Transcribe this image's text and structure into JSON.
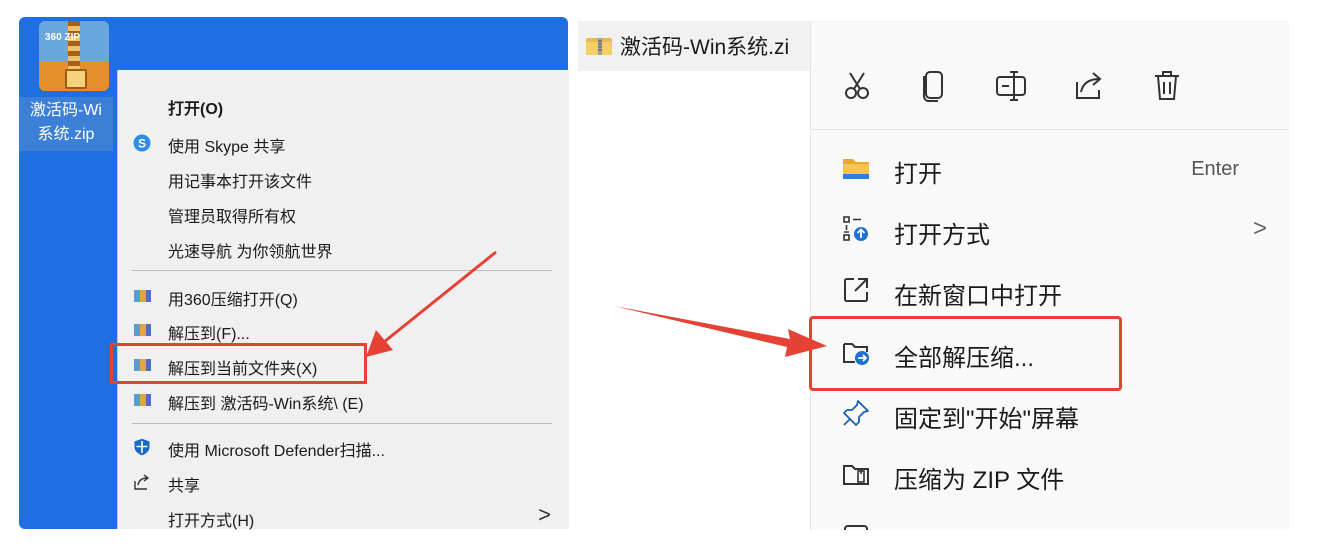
{
  "left": {
    "file_label_line1": "激活码-Wi",
    "file_label_line2": "系统.zip",
    "zip_icon_text": "360 ZIP",
    "menu": {
      "open": "打开(O)",
      "skype": "使用 Skype 共享",
      "notepad": "用记事本打开该文件",
      "admin": "管理员取得所有权",
      "guide": "光速导航 为你领航世界",
      "open360": "用360压缩打开(Q)",
      "extract_to": "解压到(F)...",
      "extract_here": "解压到当前文件夹(X)",
      "extract_named": "解压到 激活码-Win系统\\ (E)",
      "defender": "使用 Microsoft Defender扫描...",
      "share": "共享",
      "open_with": "打开方式(H)",
      "submenu_arrow": ">"
    }
  },
  "right": {
    "file_title": "激活码-Win系统.zi",
    "toolbar_icons": [
      "cut-icon",
      "copy-icon",
      "rename-icon",
      "share-icon",
      "delete-icon"
    ],
    "menu": {
      "open": "打开",
      "open_shortcut": "Enter",
      "open_with": "打开方式",
      "open_with_arrow": ">",
      "open_new_window": "在新窗口中打开",
      "extract_all": "全部解压缩...",
      "pin_start": "固定到\"开始\"屏幕",
      "compress_zip": "压缩为 ZIP 文件"
    }
  },
  "colors": {
    "desktop_blue": "#1f6ee3",
    "highlight_red": "#e54235",
    "menu_bg_win10": "#f0f0f0",
    "menu_bg_win11": "#f9f9f9"
  }
}
